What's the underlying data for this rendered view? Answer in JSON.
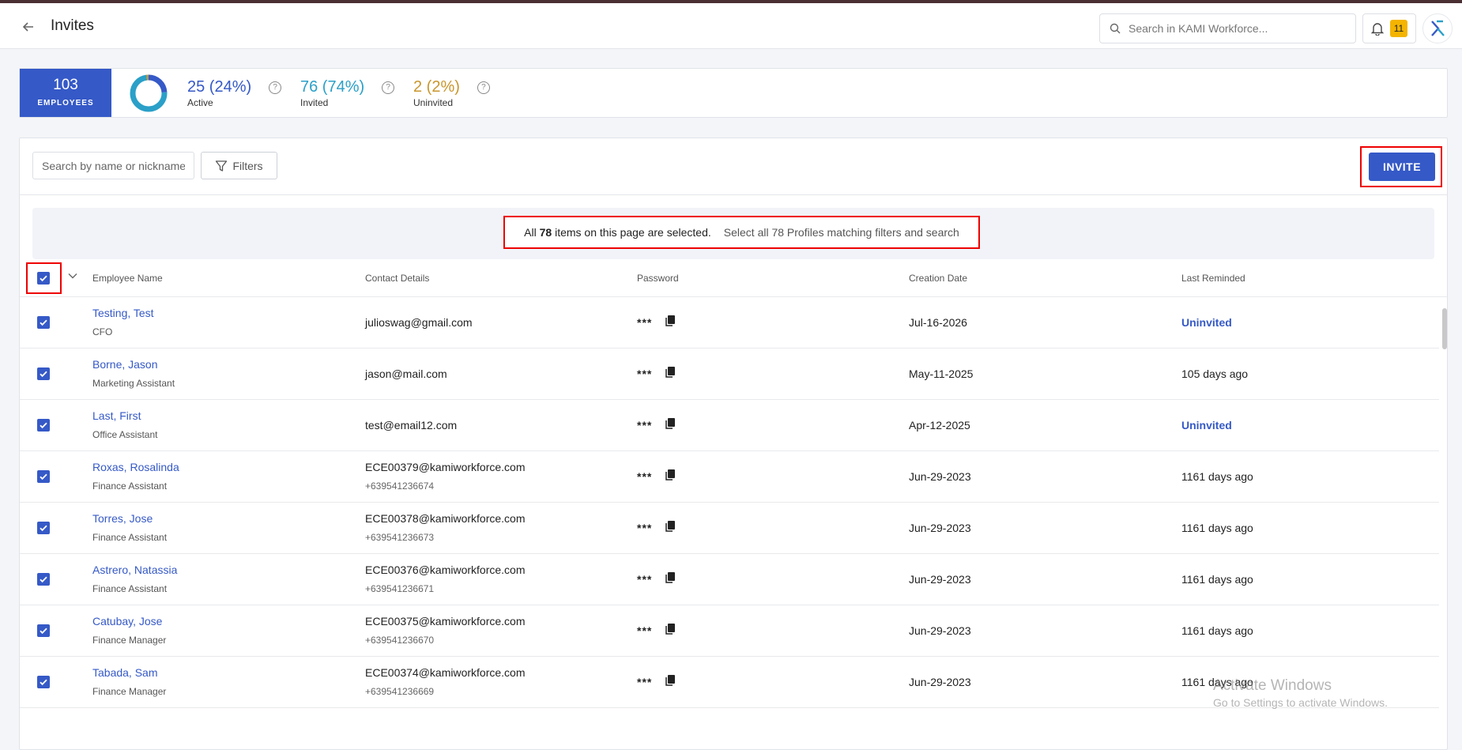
{
  "header": {
    "title": "Invites",
    "search_placeholder": "Search in KAMI Workforce...",
    "notification_count": "11"
  },
  "stats": {
    "employees_count": "103",
    "employees_label": "EMPLOYEES",
    "donut": {
      "active_fraction": 0.24,
      "invited_fraction": 0.74,
      "uninvited_fraction": 0.02
    },
    "active": {
      "value": "25 (24%)",
      "label": "Active",
      "color": "#3559c7"
    },
    "invited": {
      "value": "76 (74%)",
      "label": "Invited",
      "color": "#2aa0c8"
    },
    "uninvited": {
      "value": "2 (2%)",
      "label": "Uninvited",
      "color": "#c9962c"
    },
    "help_glyph": "?"
  },
  "toolbar": {
    "name_search_placeholder": "Search by name or nickname",
    "filters_label": "Filters",
    "invite_label": "INVITE"
  },
  "selection_banner": {
    "prefix": "All",
    "count": "78",
    "suffix": "items on this page are selected.",
    "select_all_link": "Select all 78 Profiles matching filters and search"
  },
  "table": {
    "columns": [
      "Employee Name",
      "Contact Details",
      "Password",
      "Creation Date",
      "Last Reminded"
    ],
    "rows": [
      {
        "name": "Testing, Test",
        "title": "CFO",
        "email": "julioswag@gmail.com",
        "phone": "",
        "password": "***",
        "created": "Jul-16-2026",
        "reminded": "Uninvited",
        "reminded_is_link": true
      },
      {
        "name": "Borne, Jason",
        "title": "Marketing Assistant",
        "email": "jason@mail.com",
        "phone": "",
        "password": "***",
        "created": "May-11-2025",
        "reminded": "105 days ago",
        "reminded_is_link": false
      },
      {
        "name": "Last, First",
        "title": "Office Assistant",
        "email": "test@email12.com",
        "phone": "",
        "password": "***",
        "created": "Apr-12-2025",
        "reminded": "Uninvited",
        "reminded_is_link": true
      },
      {
        "name": "Roxas, Rosalinda",
        "title": "Finance Assistant",
        "email": "ECE00379@kamiworkforce.com",
        "phone": "+639541236674",
        "password": "***",
        "created": "Jun-29-2023",
        "reminded": "1161 days ago",
        "reminded_is_link": false
      },
      {
        "name": "Torres, Jose",
        "title": "Finance Assistant",
        "email": "ECE00378@kamiworkforce.com",
        "phone": "+639541236673",
        "password": "***",
        "created": "Jun-29-2023",
        "reminded": "1161 days ago",
        "reminded_is_link": false
      },
      {
        "name": "Astrero, Natassia",
        "title": "Finance Assistant",
        "email": "ECE00376@kamiworkforce.com",
        "phone": "+639541236671",
        "password": "***",
        "created": "Jun-29-2023",
        "reminded": "1161 days ago",
        "reminded_is_link": false
      },
      {
        "name": "Catubay, Jose",
        "title": "Finance Manager",
        "email": "ECE00375@kamiworkforce.com",
        "phone": "+639541236670",
        "password": "***",
        "created": "Jun-29-2023",
        "reminded": "1161 days ago",
        "reminded_is_link": false
      },
      {
        "name": "Tabada, Sam",
        "title": "Finance Manager",
        "email": "ECE00374@kamiworkforce.com",
        "phone": "+639541236669",
        "password": "***",
        "created": "Jun-29-2023",
        "reminded": "1161 days ago",
        "reminded_is_link": false
      }
    ]
  },
  "watermark": {
    "line1": "Activate Windows",
    "line2": "Go to Settings to activate Windows."
  },
  "icons": {
    "back": "back-arrow-icon",
    "search": "search-icon",
    "bell": "bell-icon",
    "logo": "kami-logo-icon",
    "filter": "filter-icon",
    "check": "check-icon",
    "chevron": "chevron-down-icon",
    "copy": "copy-icon"
  }
}
